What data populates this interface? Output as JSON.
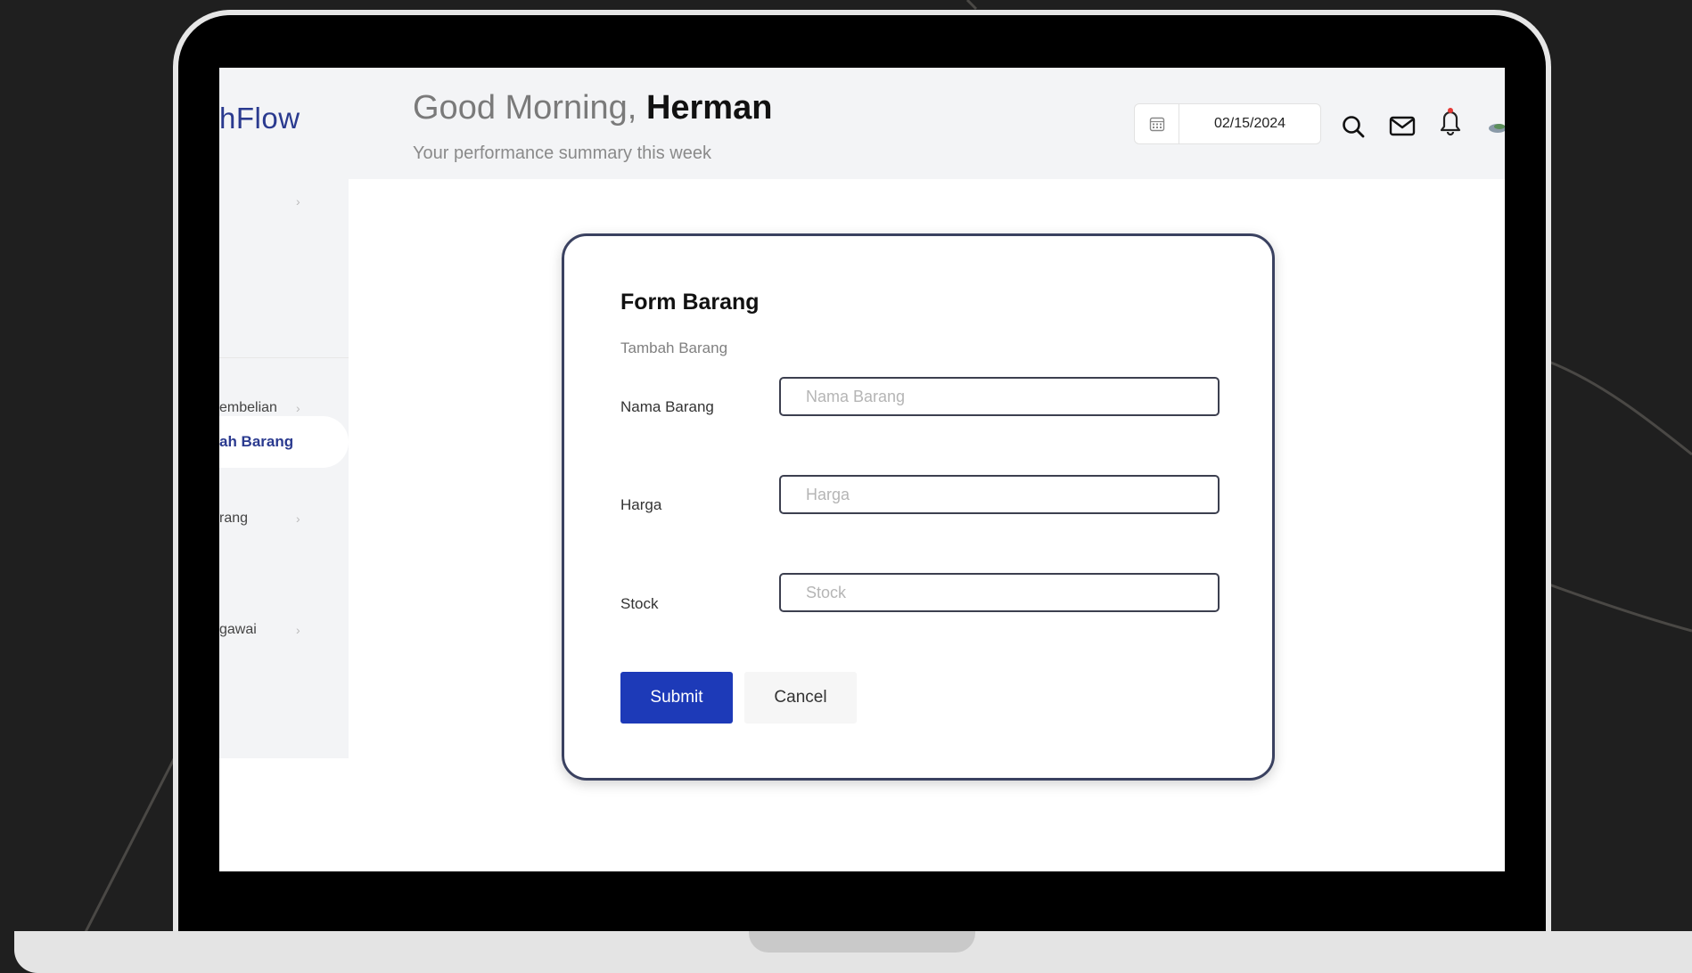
{
  "colors": {
    "brand": "#2a3a8f",
    "primary_button": "#1d3ab8",
    "notification_dot": "#e53935"
  },
  "header": {
    "brand_partial": "hFlow",
    "greeting_prefix": "Good Morning,",
    "user_name": "Herman",
    "subtitle": "Your performance summary this week",
    "date_value": "02/15/2024",
    "icons": [
      "calendar-icon",
      "search-icon",
      "mail-icon",
      "bell-icon",
      "avatar"
    ]
  },
  "sidebar": {
    "items": [
      {
        "label": "",
        "chevron": "›"
      },
      {
        "label": "embelian",
        "chevron": "›"
      },
      {
        "label": "ah Barang",
        "active": true
      },
      {
        "label": "rang",
        "chevron": "›"
      },
      {
        "label": "gawai",
        "chevron": "›"
      }
    ]
  },
  "form": {
    "title": "Form Barang",
    "subtitle": "Tambah Barang",
    "fields": [
      {
        "label": "Nama Barang",
        "placeholder": "Nama Barang",
        "value": ""
      },
      {
        "label": "Harga",
        "placeholder": "Harga",
        "value": ""
      },
      {
        "label": "Stock",
        "placeholder": "Stock",
        "value": ""
      }
    ],
    "submit_label": "Submit",
    "cancel_label": "Cancel"
  }
}
